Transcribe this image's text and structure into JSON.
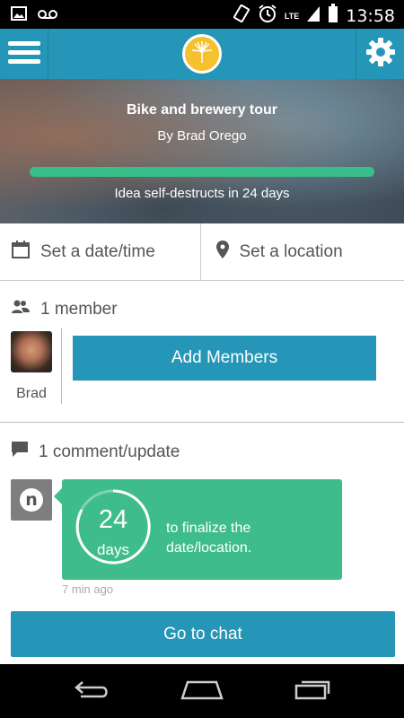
{
  "status_bar": {
    "time": "13:58",
    "network_label": "LTE",
    "icons": [
      "image-icon",
      "voicemail-icon",
      "rotate-icon",
      "alarm-icon",
      "signal-icon",
      "battery-icon"
    ]
  },
  "app_bar": {
    "icons": [
      "menu-icon",
      "dandelion-logo-icon",
      "gear-icon"
    ],
    "colors": {
      "primary": "#2596b7",
      "logo": "#f6c12d"
    }
  },
  "idea": {
    "title": "Bike and brewery tour",
    "author": "By Brad Orego",
    "expiry_text": "Idea self-destructs in 24 days",
    "progress_fraction": 1.0,
    "progress_color": "#39c08a"
  },
  "details": {
    "date_label": "Set a date/time",
    "location_label": "Set a location"
  },
  "members": {
    "heading": "1 member",
    "list": [
      {
        "name": "Brad"
      }
    ],
    "add_button": "Add Members"
  },
  "comments": {
    "heading": "1 comment/update",
    "items": [
      {
        "sender_initial": "n",
        "countdown_value": "24",
        "countdown_unit": "days",
        "message": "to finalize the date/location.",
        "time": "7 min ago"
      }
    ],
    "bubble_color": "#3ebd8a",
    "chat_button": "Go to chat"
  },
  "nav_bar": {
    "icons": [
      "back-icon",
      "home-icon",
      "recent-apps-icon"
    ]
  }
}
